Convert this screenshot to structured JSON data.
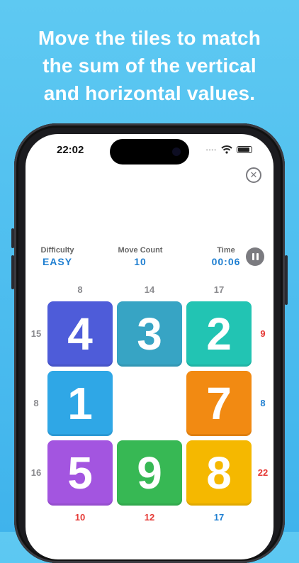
{
  "headline": [
    "Move the tiles to match",
    "the sum of the vertical",
    "and horizontal values."
  ],
  "status_bar": {
    "time": "22:02",
    "dots": "••••"
  },
  "header": {
    "difficulty_label": "Difficulty",
    "difficulty_value": "EASY",
    "move_label": "Move Count",
    "move_value": "10",
    "time_label": "Time",
    "time_value": "00:06"
  },
  "grid": {
    "top_clues": [
      "8",
      "14",
      "17"
    ],
    "left_clues": [
      "15",
      "8",
      "16"
    ],
    "right_clues": [
      "9",
      "8",
      "22"
    ],
    "bottom_clues": [
      "10",
      "12",
      "17"
    ],
    "tiles": [
      {
        "value": "4",
        "color": "#4e5cd9"
      },
      {
        "value": "3",
        "color": "#37a4c4"
      },
      {
        "value": "2",
        "color": "#22c4b3"
      },
      {
        "value": "1",
        "color": "#2fa7e6"
      },
      {
        "value": "",
        "color": ""
      },
      {
        "value": "7",
        "color": "#f28a12"
      },
      {
        "value": "5",
        "color": "#a355e0"
      },
      {
        "value": "9",
        "color": "#37b854"
      },
      {
        "value": "8",
        "color": "#f5b800"
      }
    ]
  },
  "colors": {
    "background": "#4fbff0",
    "accent_blue": "#1f7fd1",
    "clue_red": "#e53935",
    "clue_gray": "#8a8a8e"
  },
  "icons": [
    "close-icon",
    "pause-icon",
    "wifi-icon",
    "battery-icon"
  ]
}
